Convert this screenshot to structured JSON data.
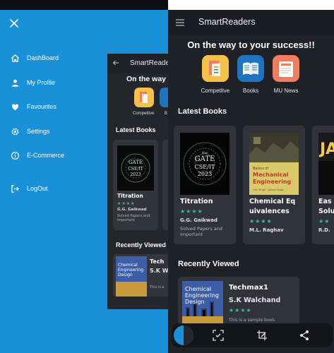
{
  "drawer": {
    "items": [
      {
        "label": "DashBoard",
        "icon": "home-icon"
      },
      {
        "label": "My Profile",
        "icon": "person-icon"
      },
      {
        "label": "Favourites",
        "icon": "heart-icon"
      },
      {
        "label": "Settings",
        "icon": "gear-icon"
      },
      {
        "label": "E-Commerce",
        "icon": "info-icon"
      },
      {
        "label": "LogOut",
        "icon": "logout-icon"
      }
    ]
  },
  "app": {
    "title": "SmartReaders",
    "tagline": "On the way to your success!!",
    "categories": [
      {
        "label": "Competitve",
        "color": "#f5c04a"
      },
      {
        "label": "Books",
        "color": "#1f74c2"
      },
      {
        "label": "MU News",
        "color": "#f07d5d"
      }
    ],
    "latest_books_title": "Latest Books",
    "recently_viewed_title": "Recently Viewed",
    "books": [
      {
        "title": "Titration",
        "author": "G.G. Gaikwad",
        "desc": "Solved Papers and important",
        "stars": "★★★★",
        "cover": "GATE CSE/IT 2023",
        "cover_sub": "the"
      },
      {
        "title": "Chemical Eq uivalences",
        "author": "M.L. Raghav",
        "desc": "",
        "stars": "★★★★",
        "cover": "Mechanical Engineering",
        "cover_sub": "Basics of"
      },
      {
        "title": "Eas Solu",
        "author": "R.D.",
        "desc": "",
        "stars": "★★",
        "cover": "JA",
        "cover_sub": ""
      }
    ],
    "recent": {
      "title": "Techmax1",
      "author": "S.K Walchand",
      "stars": "★★★★",
      "desc": "This is a sample book.",
      "cover": "Chemical Engineering Design"
    }
  },
  "mini": {
    "title": "SmartReaders",
    "tagline": "On the way t",
    "categories": [
      {
        "label": "Competitve"
      },
      {
        "label": "B"
      }
    ],
    "latest_books_title": "Latest Books",
    "recently_viewed_title": "Recently Viewed",
    "book": {
      "title": "Titration",
      "author": "G.G. Gaikwad",
      "desc": "Solved Papers and important",
      "stars": "★★★★"
    },
    "recent": {
      "title": "Tech",
      "author": "S.K W",
      "desc": "This is a",
      "cover": "Chemical Engineering Design"
    }
  }
}
